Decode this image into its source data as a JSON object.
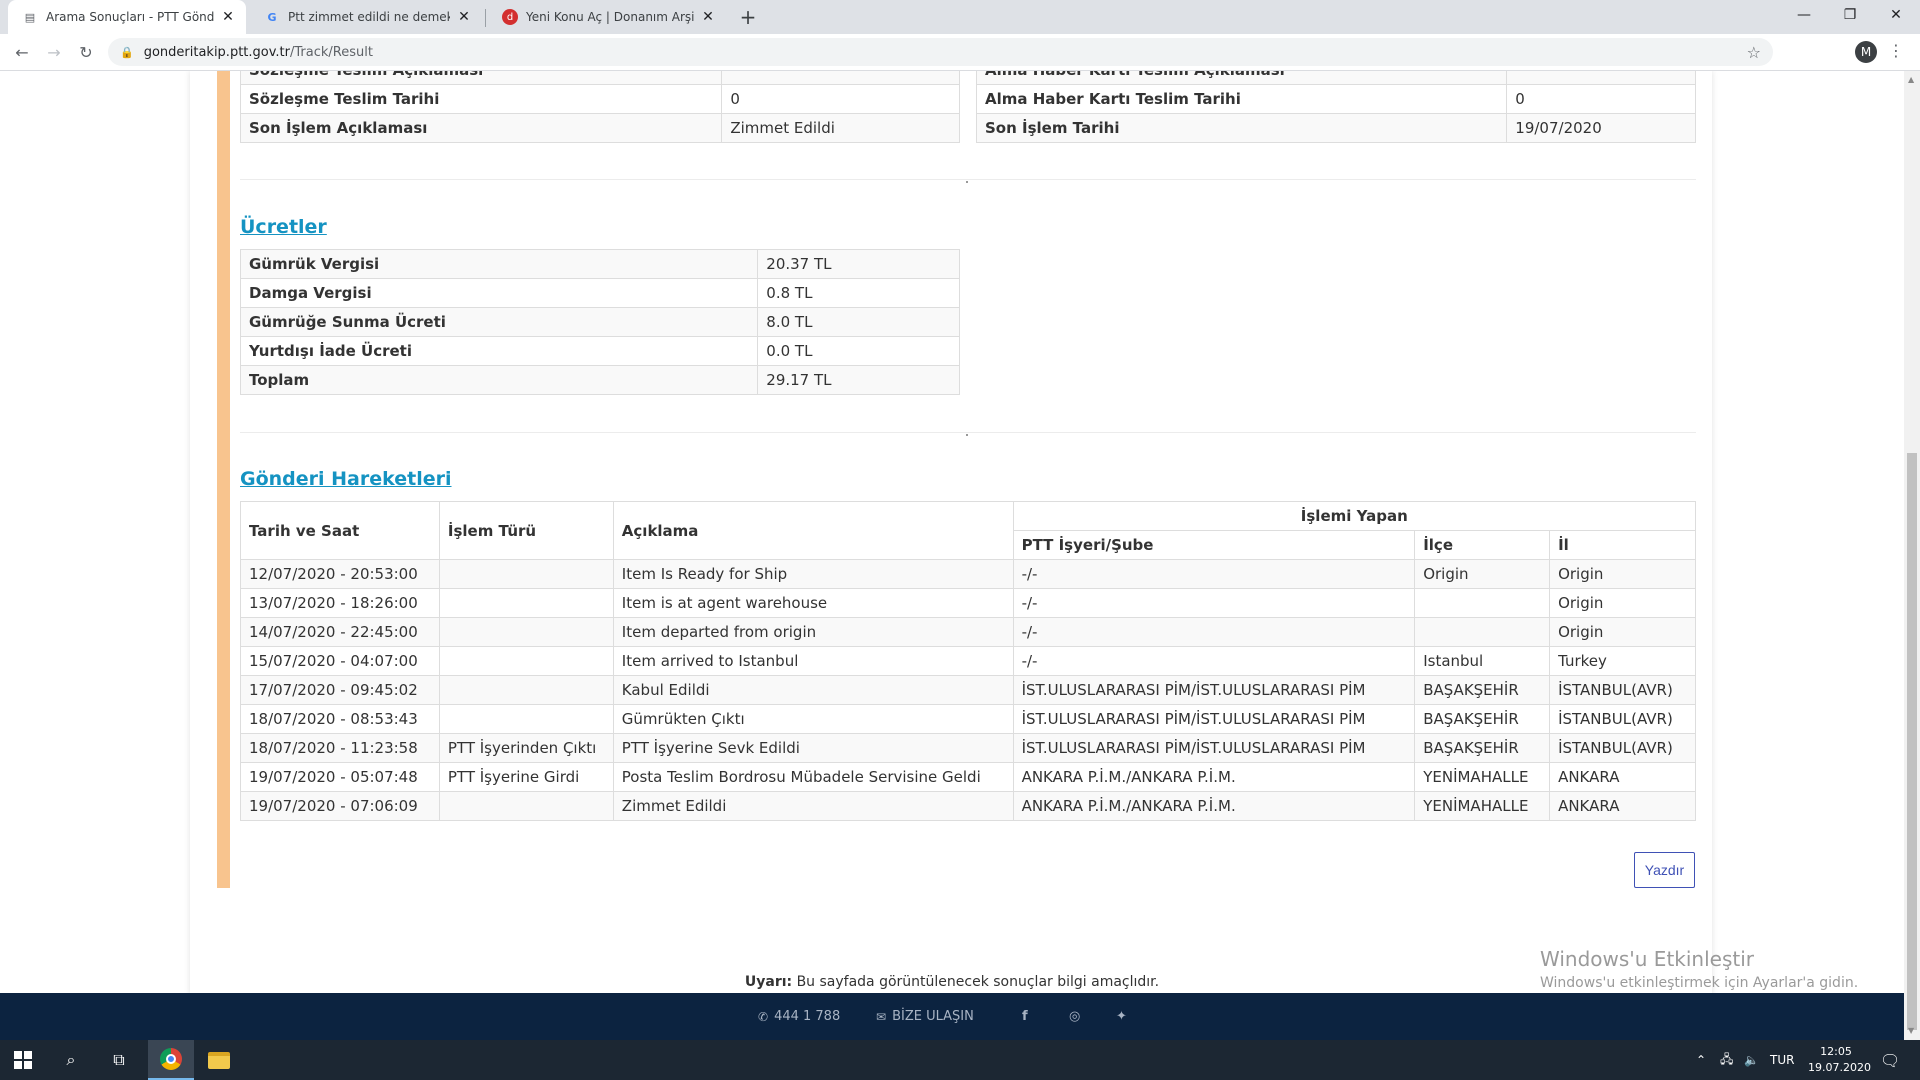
{
  "browser": {
    "tabs": [
      {
        "title": "Arama Sonuçları - PTT Gönderi Ta",
        "favicon": "page-icon"
      },
      {
        "title": "Ptt zimmet edildi ne demek - Goo",
        "favicon": "google-icon"
      },
      {
        "title": "Yeni Konu Aç | Donanım Arşivi Fo",
        "favicon": "donanim-icon"
      }
    ],
    "url_host": "gonderitakip.ptt.gov.tr",
    "url_path": "/Track/Result",
    "profile_initial": "M"
  },
  "top_table": {
    "left": [
      {
        "label": "Sözleşme Teslim Açıklaması",
        "value": ""
      },
      {
        "label": "Sözleşme Teslim Tarihi",
        "value": "0"
      },
      {
        "label": "Son İşlem Açıklaması",
        "value": "Zimmet Edildi"
      }
    ],
    "right": [
      {
        "label": "Alma Haber Kartı Teslim Açıklaması",
        "value": ""
      },
      {
        "label": "Alma Haber Kartı Teslim Tarihi",
        "value": "0"
      },
      {
        "label": "Son İşlem Tarihi",
        "value": "19/07/2020"
      }
    ]
  },
  "fees": {
    "title": "Ücretler",
    "rows": [
      {
        "label": "Gümrük Vergisi",
        "value": "20.37 TL"
      },
      {
        "label": "Damga Vergisi",
        "value": "0.8 TL"
      },
      {
        "label": "Gümrüğe Sunma Ücreti",
        "value": "8.0 TL"
      },
      {
        "label": "Yurtdışı İade Ücreti",
        "value": "0.0 TL"
      },
      {
        "label": "Toplam",
        "value": "29.17 TL"
      }
    ]
  },
  "movements": {
    "title": "Gönderi Hareketleri",
    "headers": {
      "date": "Tarih ve Saat",
      "type": "İşlem Türü",
      "desc": "Açıklama",
      "performer": "İşlemi Yapan",
      "branch": "PTT İşyeri/Şube",
      "district": "İlçe",
      "city": "İl"
    },
    "rows": [
      {
        "date": "12/07/2020 - 20:53:00",
        "type": "",
        "desc": "Item Is Ready for Ship",
        "branch": "-/-",
        "district": "Origin",
        "city": "Origin"
      },
      {
        "date": "13/07/2020 - 18:26:00",
        "type": "",
        "desc": "Item is at agent warehouse",
        "branch": "-/-",
        "district": "",
        "city": "Origin"
      },
      {
        "date": "14/07/2020 - 22:45:00",
        "type": "",
        "desc": "Item departed from origin",
        "branch": "-/-",
        "district": "",
        "city": "Origin"
      },
      {
        "date": "15/07/2020 - 04:07:00",
        "type": "",
        "desc": "Item arrived to Istanbul",
        "branch": "-/-",
        "district": "Istanbul",
        "city": "Turkey"
      },
      {
        "date": "17/07/2020 - 09:45:02",
        "type": "",
        "desc": "Kabul Edildi",
        "branch": "İST.ULUSLARARASI PİM/İST.ULUSLARARASI PİM",
        "district": "BAŞAKŞEHİR",
        "city": "İSTANBUL(AVR)"
      },
      {
        "date": "18/07/2020 - 08:53:43",
        "type": "",
        "desc": "Gümrükten Çıktı",
        "branch": "İST.ULUSLARARASI PİM/İST.ULUSLARARASI PİM",
        "district": "BAŞAKŞEHİR",
        "city": "İSTANBUL(AVR)"
      },
      {
        "date": "18/07/2020 - 11:23:58",
        "type": "PTT İşyerinden Çıktı",
        "desc": "PTT İşyerine Sevk Edildi",
        "branch": "İST.ULUSLARARASI PİM/İST.ULUSLARARASI PİM",
        "district": "BAŞAKŞEHİR",
        "city": "İSTANBUL(AVR)"
      },
      {
        "date": "19/07/2020 - 05:07:48",
        "type": "PTT İşyerine Girdi",
        "desc": "Posta Teslim Bordrosu Mübadele Servisine Geldi",
        "branch": "ANKARA P.İ.M./ANKARA P.İ.M.",
        "district": "YENİMAHALLE",
        "city": "ANKARA"
      },
      {
        "date": "19/07/2020 - 07:06:09",
        "type": "",
        "desc": "Zimmet Edildi",
        "branch": "ANKARA P.İ.M./ANKARA P.İ.M.",
        "district": "YENİMAHALLE",
        "city": "ANKARA"
      }
    ]
  },
  "print_label": "Yazdır",
  "notice": {
    "strong": "Uyarı:",
    "text": " Bu sayfada görüntülenecek sonuçlar bilgi amaçlıdır."
  },
  "footer": {
    "phone": "444 1 788",
    "contact": "BİZE ULAŞIN"
  },
  "watermark": {
    "title": "Windows'u Etkinleştir",
    "text": "Windows'u etkinleştirmek için Ayarlar'a gidin."
  },
  "taskbar": {
    "lang": "TUR",
    "time": "12:05",
    "date": "19.07.2020"
  }
}
